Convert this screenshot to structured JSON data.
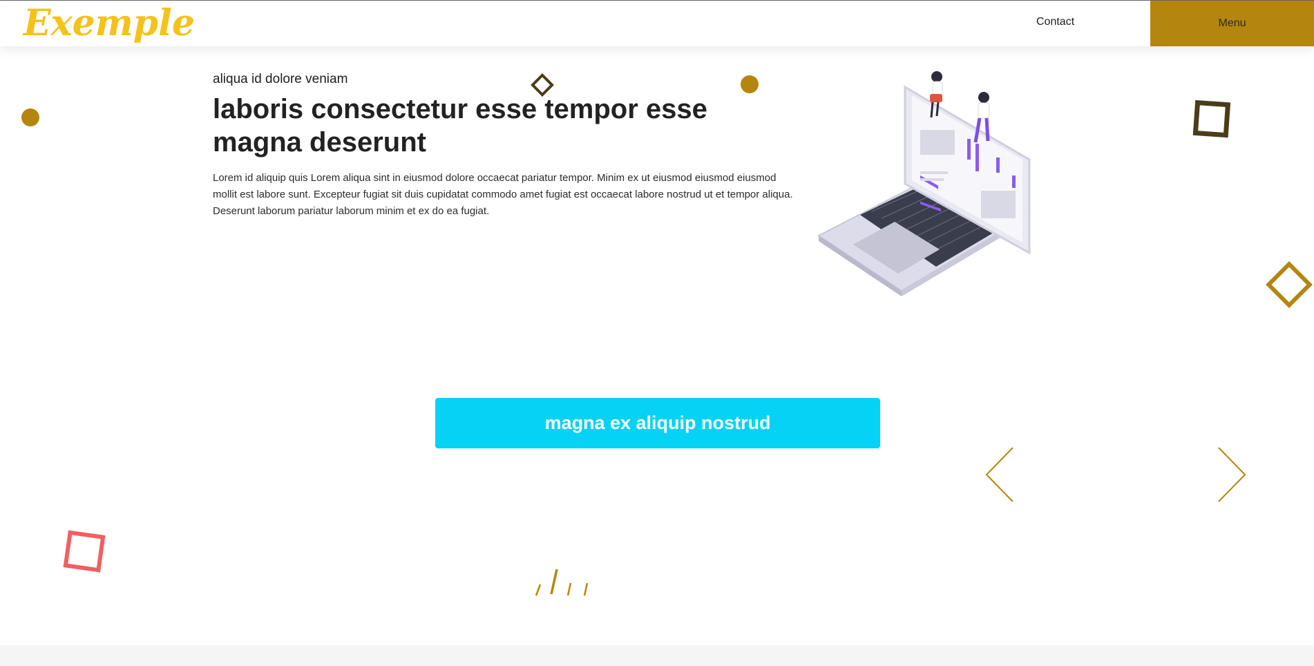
{
  "header": {
    "logo": "Exemple",
    "nav": {
      "contact_label": "Contact",
      "menu_label": "Menu"
    }
  },
  "hero": {
    "eyebrow": "aliqua id dolore veniam",
    "headline": "laboris consectetur esse tempor esse magna deserunt",
    "body": "Lorem id aliquip quis Lorem aliqua sint in eiusmod dolore occaecat pariatur tempor. Minim ex ut eiusmod eiusmod eiusmod mollit est labore sunt. Excepteur fugiat sit duis cupidatat commodo amet fugiat est occaecat labore nostrud ut et tempor aliqua. Deserunt laborum pariatur laborum minim et ex do ea fugiat.",
    "cta_label": "magna ex aliquip nostrud"
  },
  "carousel": {
    "prev_icon": "chevron-left-icon",
    "next_icon": "chevron-right-icon"
  },
  "colors": {
    "brand_gold": "#b5860d",
    "logo_yellow": "#f5c21b",
    "cta_cyan": "#05d2f5",
    "accent_red": "#f06060",
    "dark_olive": "#4a3d1a"
  }
}
